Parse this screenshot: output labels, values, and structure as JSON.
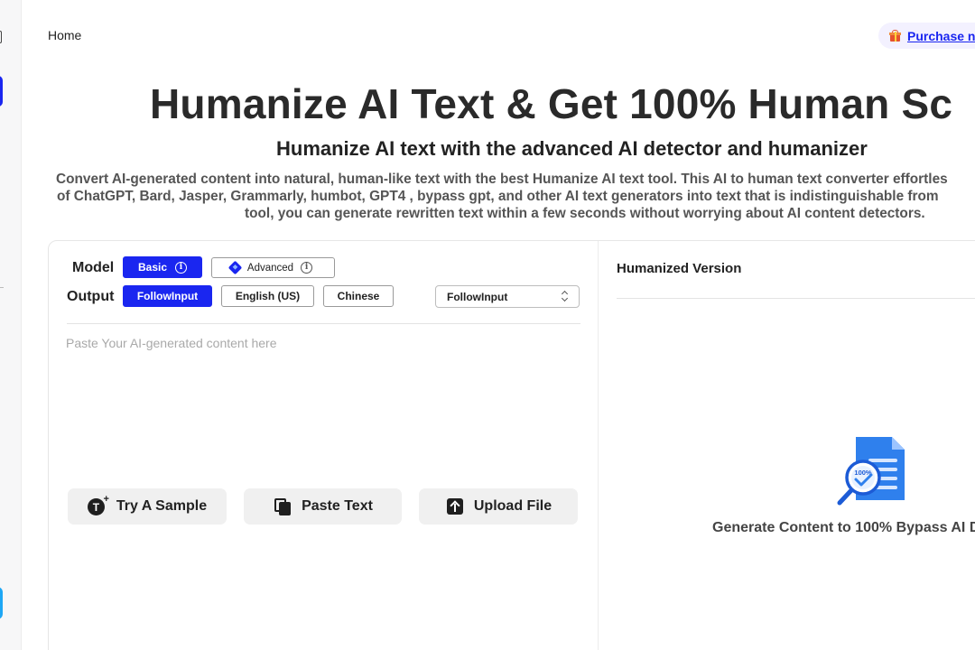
{
  "nav": {
    "home": "Home",
    "purchase": "Purchase n"
  },
  "hero": {
    "title": "Humanize AI Text & Get 100% Human Sc",
    "subtitle": "Humanize AI text with the advanced AI detector and humanizer",
    "description_lines": [
      "Convert AI-generated content into natural, human-like text with the best Humanize AI text tool. This AI to human text converter effortles",
      "of ChatGPT, Bard, Jasper, Grammarly, humbot, GPT4 , bypass gpt, and other AI text generators into text that is indistinguishable from",
      "tool, you can generate rewritten text within a few seconds without worrying about AI content detectors."
    ]
  },
  "editor": {
    "model_label": "Model",
    "output_label": "Output",
    "model_options": [
      {
        "label": "Basic",
        "selected": true
      },
      {
        "label": "Advanced",
        "selected": false
      }
    ],
    "output_options": [
      {
        "label": "FollowInput",
        "selected": true
      },
      {
        "label": "English (US)",
        "selected": false
      },
      {
        "label": "Chinese",
        "selected": false
      }
    ],
    "language_select": "FollowInput",
    "input_placeholder": "Paste Your AI-generated content here",
    "input_value": "",
    "buttons": {
      "sample": "Try A Sample",
      "paste": "Paste Text",
      "upload": "Upload File"
    }
  },
  "output_panel": {
    "title": "Humanized Version",
    "empty_caption": "Generate Content to 100% Bypass AI D",
    "badge_text": "100%"
  },
  "colors": {
    "accent": "#1a26f0",
    "illustration_blue": "#2f80ed"
  },
  "icons": [
    "gift-icon",
    "info-icon",
    "diamond-icon",
    "text-sample-icon",
    "paste-icon",
    "upload-icon",
    "chevron-updown-icon",
    "document-check-icon"
  ]
}
